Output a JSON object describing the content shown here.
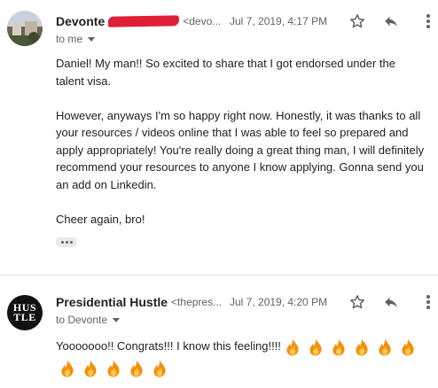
{
  "messages": [
    {
      "sender_name": "Devonte",
      "sender_email": "<devo...",
      "date": "Jul 7, 2019, 4:17 PM",
      "recipient": "to me",
      "body": [
        "Daniel! My man!! So excited to share that I got endorsed under the talent visa.",
        "However, anyways I'm so happy right now. Honestly, it was thanks to all your resources / videos online that I was able to feel so prepared and apply appropriately! You're really doing a great thing man, I will definitely recommend your resources to anyone I know applying. Gonna send you an add on Linkedin.",
        "Cheer again, bro!"
      ]
    },
    {
      "sender_name": "Presidential Hustle",
      "sender_email": "<thepres...",
      "date": "Jul 7, 2019, 4:20 PM",
      "recipient": "to Devonte",
      "avatar_text": [
        "HUS",
        "TLE"
      ],
      "body_line": "Yooooooo!!  Congrats!!! I know this feeling!!!!",
      "fire_emoji_count_line1": 6,
      "fire_emoji_count_line2": 5
    }
  ],
  "icons": {
    "star": "star-outline-icon",
    "reply": "reply-arrow-icon",
    "more": "more-vertical-icon",
    "fire": "fire-emoji"
  },
  "colors": {
    "redaction": "#e01e37",
    "fire_outer": "#f4900c",
    "fire_inner": "#ffcc4d"
  }
}
